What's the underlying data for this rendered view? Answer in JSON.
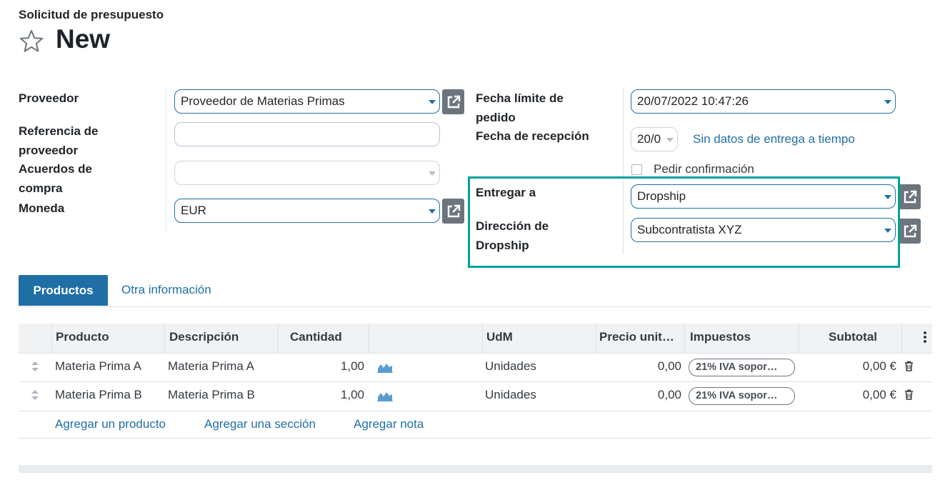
{
  "header": {
    "breadcrumb": "Solicitud de presupuesto",
    "title": "New"
  },
  "form": {
    "left": {
      "vendor_label": "Proveedor",
      "vendor_value": "Proveedor de Materias Primas",
      "vendor_ref_label_1": "Referencia de",
      "vendor_ref_label_2": "proveedor",
      "vendor_ref_value": "",
      "agreement_label_1": "Acuerdos de",
      "agreement_label_2": "compra",
      "agreement_value": "",
      "currency_label": "Moneda",
      "currency_value": "EUR"
    },
    "right": {
      "order_deadline_label_1": "Fecha límite de",
      "order_deadline_label_2": "pedido",
      "order_deadline_value": "20/07/2022 10:47:26",
      "receipt_date_label": "Fecha de recepción",
      "receipt_date_value": "20/0",
      "on_time_link": "Sin datos de entrega a tiempo",
      "confirm_label": "Pedir confirmación",
      "deliver_to_label": "Entregar a",
      "deliver_to_value": "Dropship",
      "dropship_address_label_1": "Dirección de",
      "dropship_address_label_2": "Dropship",
      "dropship_address_value": "Subcontratista XYZ"
    }
  },
  "tabs": [
    {
      "label": "Productos",
      "active": true
    },
    {
      "label": "Otra información",
      "active": false
    }
  ],
  "table": {
    "columns": [
      "Producto",
      "Descripción",
      "Cantidad",
      "UdM",
      "Precio unit…",
      "Impuestos",
      "Subtotal"
    ],
    "rows": [
      {
        "product": "Materia Prima A",
        "description": "Materia Prima A",
        "quantity": "1,00",
        "uom": "Unidades",
        "price": "0,00",
        "tax": "21% IVA sopor…",
        "subtotal": "0,00 €"
      },
      {
        "product": "Materia Prima B",
        "description": "Materia Prima B",
        "quantity": "1,00",
        "uom": "Unidades",
        "price": "0,00",
        "tax": "21% IVA sopor…",
        "subtotal": "0,00 €"
      }
    ],
    "add_links": [
      "Agregar un producto",
      "Agregar una sección",
      "Agregar nota"
    ]
  },
  "colors": {
    "primary": "#1f6fa6",
    "highlight": "#00a09d",
    "button_gray": "#6c757d"
  },
  "icons": [
    "star-icon",
    "external-link-icon",
    "chevron-down-icon",
    "drag-handle-icon",
    "forecast-chart-icon",
    "trash-icon",
    "kebab-menu-icon"
  ]
}
